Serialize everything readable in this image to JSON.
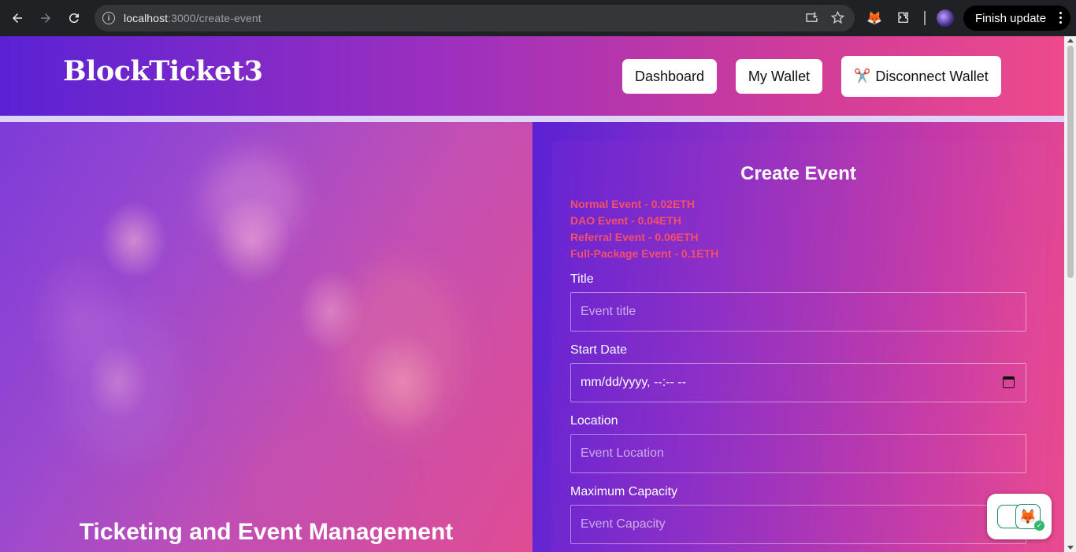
{
  "browser": {
    "url_host": "localhost",
    "url_path": ":3000/create-event",
    "finish_update_label": "Finish update"
  },
  "header": {
    "logo": "BlockTicket3",
    "nav": {
      "dashboard": "Dashboard",
      "wallet": "My Wallet",
      "disconnect": "Disconnect Wallet",
      "disconnect_icon": "✂️"
    }
  },
  "hero": {
    "title": "Ticketing and Event Management"
  },
  "form": {
    "title": "Create Event",
    "prices": [
      "Normal Event - 0.02ETH",
      "DAO Event - 0.04ETH",
      "Referral Event - 0.06ETH",
      "Full-Package Event - 0.1ETH"
    ],
    "fields": {
      "title": {
        "label": "Title",
        "placeholder": "Event title"
      },
      "start_date": {
        "label": "Start Date",
        "value": "mm/dd/yyyy, --:-- --"
      },
      "location": {
        "label": "Location",
        "placeholder": "Event Location"
      },
      "capacity": {
        "label": "Maximum Capacity",
        "placeholder": "Event Capacity"
      }
    }
  },
  "colors": {
    "header_start": "#5a22d4",
    "header_end": "#ee4a8c",
    "price_text": "#f4506a"
  },
  "icons": {
    "metamask_widget": "fox-icon"
  }
}
